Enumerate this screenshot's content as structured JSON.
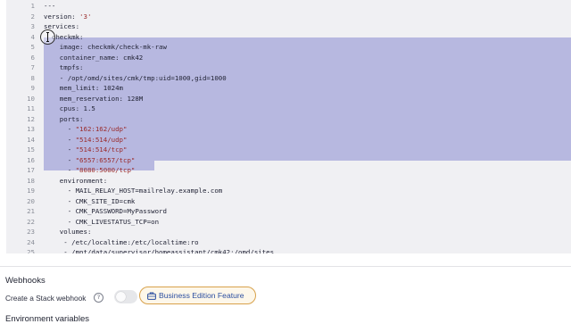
{
  "editor": {
    "lines": [
      {
        "n": "1",
        "parts": [
          {
            "t": "---",
            "c": "k"
          }
        ]
      },
      {
        "n": "2",
        "parts": [
          {
            "t": "version: ",
            "c": "k"
          },
          {
            "t": "'3'",
            "c": "s"
          }
        ]
      },
      {
        "n": "3",
        "parts": [
          {
            "t": "services:",
            "c": "k"
          }
        ]
      },
      {
        "n": "4",
        "parts": [
          {
            "t": "  checkmk:",
            "c": "k"
          }
        ]
      },
      {
        "n": "5",
        "parts": [
          {
            "t": "    image: ",
            "c": "k"
          },
          {
            "t": "checkmk/check-mk-raw",
            "c": "n"
          }
        ]
      },
      {
        "n": "6",
        "parts": [
          {
            "t": "    container_name: ",
            "c": "k"
          },
          {
            "t": "cmk42",
            "c": "n"
          }
        ]
      },
      {
        "n": "7",
        "parts": [
          {
            "t": "    tmpfs:",
            "c": "k"
          }
        ]
      },
      {
        "n": "8",
        "parts": [
          {
            "t": "    - /opt/omd/sites/cmk/tmp:uid=1000,gid=1000",
            "c": "n"
          }
        ]
      },
      {
        "n": "9",
        "parts": [
          {
            "t": "    mem_limit: ",
            "c": "k"
          },
          {
            "t": "1024m",
            "c": "n"
          }
        ]
      },
      {
        "n": "10",
        "parts": [
          {
            "t": "    mem_reservation: ",
            "c": "k"
          },
          {
            "t": "128M",
            "c": "n"
          }
        ]
      },
      {
        "n": "11",
        "parts": [
          {
            "t": "    cpus: ",
            "c": "k"
          },
          {
            "t": "1.5",
            "c": "n"
          }
        ]
      },
      {
        "n": "12",
        "parts": [
          {
            "t": "    ports:",
            "c": "k"
          }
        ]
      },
      {
        "n": "13",
        "parts": [
          {
            "t": "      - ",
            "c": "dash"
          },
          {
            "t": "\"162:162/udp\"",
            "c": "s"
          }
        ]
      },
      {
        "n": "14",
        "parts": [
          {
            "t": "      - ",
            "c": "dash"
          },
          {
            "t": "\"514:514/udp\"",
            "c": "s"
          }
        ]
      },
      {
        "n": "15",
        "parts": [
          {
            "t": "      - ",
            "c": "dash"
          },
          {
            "t": "\"514:514/tcp\"",
            "c": "s"
          }
        ]
      },
      {
        "n": "16",
        "parts": [
          {
            "t": "      - ",
            "c": "dash"
          },
          {
            "t": "\"6557:6557/tcp\"",
            "c": "s"
          }
        ]
      },
      {
        "n": "17",
        "parts": [
          {
            "t": "      - ",
            "c": "dash"
          },
          {
            "t": "\"8080:5000/tcp\"",
            "c": "s"
          }
        ]
      },
      {
        "n": "18",
        "parts": [
          {
            "t": "    environment:",
            "c": "k"
          }
        ]
      },
      {
        "n": "19",
        "parts": [
          {
            "t": "      - MAIL_RELAY_HOST=mailrelay.example.com",
            "c": "n"
          }
        ]
      },
      {
        "n": "20",
        "parts": [
          {
            "t": "      - CMK_SITE_ID=cmk",
            "c": "n"
          }
        ]
      },
      {
        "n": "21",
        "parts": [
          {
            "t": "      - CMK_PASSWORD=MyPassword",
            "c": "n"
          }
        ]
      },
      {
        "n": "22",
        "parts": [
          {
            "t": "      - CMK_LIVESTATUS_TCP=on",
            "c": "n"
          }
        ]
      },
      {
        "n": "23",
        "parts": [
          {
            "t": "    volumes:",
            "c": "k"
          }
        ]
      },
      {
        "n": "24",
        "parts": [
          {
            "t": "     - /etc/localtime:/etc/localtime:ro",
            "c": "n"
          }
        ]
      },
      {
        "n": "25",
        "parts": [
          {
            "t": "     - /mnt/data/supervisor/homeassistant/cmk42:/omd/sites",
            "c": "n"
          }
        ]
      }
    ]
  },
  "webhooks": {
    "title": "Webhooks",
    "create_label": "Create a Stack webhook",
    "help_icon": "?",
    "badge_label": "Business Edition Feature",
    "badge_icon": "briefcase-icon",
    "toggle_on": false
  },
  "next_section": {
    "title": "Environment variables"
  },
  "colors": {
    "selection": "#b7b8e0",
    "editor_bg": "#f0f0f3",
    "badge_border": "#d8a24b",
    "badge_text": "#2b4ea0",
    "string": "#9a2a2a"
  }
}
